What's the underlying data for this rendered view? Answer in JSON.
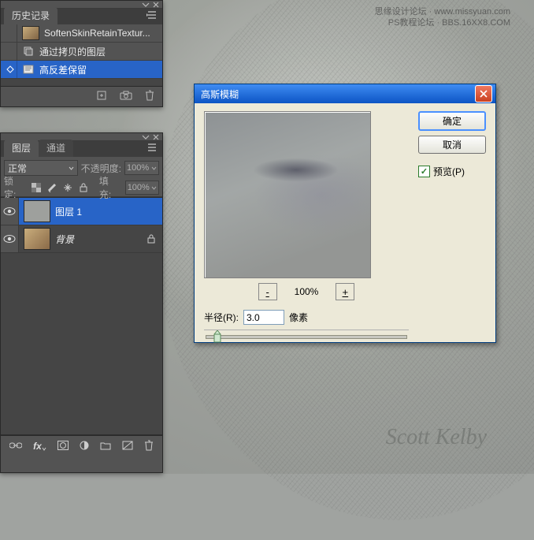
{
  "watermark": {
    "line1": "思缘设计论坛 · www.missyuan.com",
    "line2": "PS教程论坛 · BBS.16XX8.COM"
  },
  "signature": "Scott Kelby",
  "history": {
    "tab": "历史记录",
    "snapshot": "SoftenSkinRetainTextur...",
    "items": [
      {
        "label": "通过拷贝的图层"
      },
      {
        "label": "高反差保留"
      }
    ]
  },
  "layers": {
    "tab1": "图层",
    "tab2": "通道",
    "blend_mode": "正常",
    "opacity_label": "不透明度:",
    "opacity_value": "100%",
    "lock_label": "锁定:",
    "fill_label": "填充:",
    "fill_value": "100%",
    "items": [
      {
        "name": "图层 1"
      },
      {
        "name": "背景"
      }
    ]
  },
  "dialog": {
    "title": "高斯模糊",
    "ok": "确定",
    "cancel": "取消",
    "preview": "预览(P)",
    "zoom": "100%",
    "radius_label": "半径(R):",
    "radius_value": "3.0",
    "radius_unit": "像素"
  }
}
